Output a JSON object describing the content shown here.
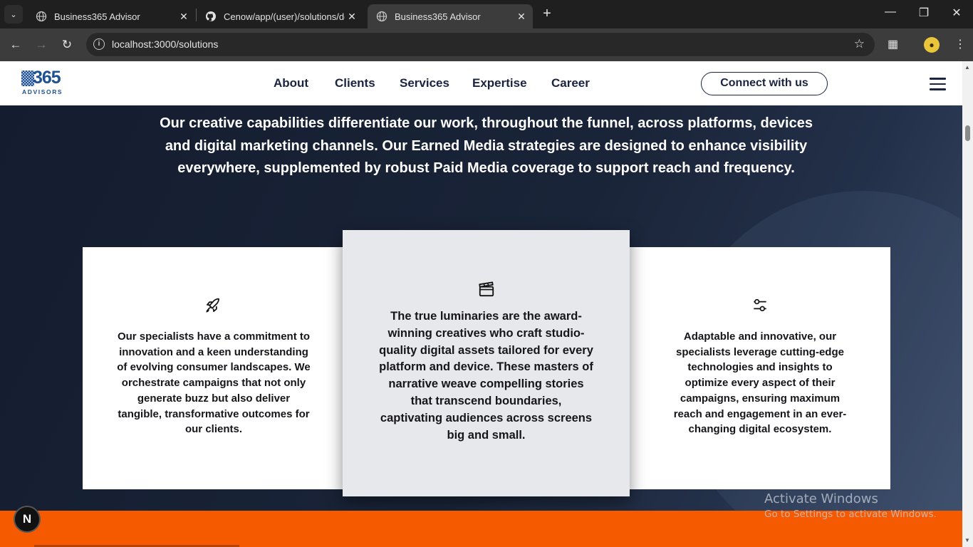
{
  "browser": {
    "tabs": [
      {
        "title": "Business365 Advisor",
        "active": false,
        "icon": "globe-icon"
      },
      {
        "title": "Cenow/app/(user)/solutions/de",
        "active": false,
        "icon": "github-icon"
      },
      {
        "title": "Business365 Advisor",
        "active": true,
        "icon": "globe-icon"
      }
    ],
    "url": "localhost:3000/solutions"
  },
  "site": {
    "logo": {
      "number": "365",
      "subtitle": "ADVISORS"
    },
    "nav": [
      "About",
      "Clients",
      "Services",
      "Expertise",
      "Career"
    ],
    "cta": "Connect with us"
  },
  "hero": {
    "intro": "Our creative capabilities differentiate our work, throughout the funnel, across platforms, devices and digital marketing channels. Our Earned Media strategies are designed to enhance visibility everywhere, supplemented by robust Paid Media coverage to support reach and frequency.",
    "cards": [
      {
        "icon": "rocket-icon",
        "text": "Our specialists have a commitment to innovation and a keen understanding of evolving consumer landscapes. We orchestrate campaigns that not only generate buzz but also deliver tangible, transformative outcomes for our clients."
      },
      {
        "icon": "clapperboard-icon",
        "text": "The true luminaries are the award-winning creatives who craft studio-quality digital assets tailored for every platform and device. These masters of narrative weave compelling stories that transcend boundaries, captivating audiences across screens big and small."
      },
      {
        "icon": "sliders-icon",
        "text": "Adaptable and innovative, our specialists leverage cutting-edge technologies and insights to optimize every aspect of their campaigns, ensuring maximum reach and engagement in an ever-changing digital ecosystem."
      }
    ]
  },
  "overlays": {
    "n_badge": "N",
    "activate_title": "Activate Windows",
    "activate_sub": "Go to Settings to activate Windows."
  },
  "colors": {
    "accent_orange": "#f55a00",
    "navy": "#1a2340",
    "brand_blue": "#1d4f91",
    "hero_bg": "#1b2436"
  }
}
